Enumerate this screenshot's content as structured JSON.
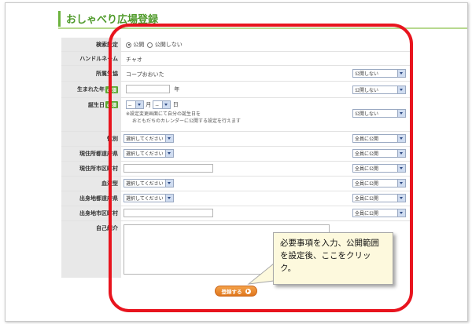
{
  "page": {
    "title": "おしゃべり広場登録"
  },
  "form": {
    "search": {
      "label": "検索設定",
      "option_public": "公開",
      "option_private": "公開しない"
    },
    "handle": {
      "label": "ハンドルネーム",
      "value": "チャオ"
    },
    "coop": {
      "label": "所属生協",
      "value": "コープおおいた",
      "visibility": "公開しない"
    },
    "birth_year": {
      "label": "生まれた年",
      "required": "必須",
      "unit": "年",
      "visibility": "公開しない"
    },
    "birthday": {
      "label": "誕生日",
      "required": "必須",
      "month_value": "--",
      "month_unit": "月",
      "day_value": "--",
      "day_unit": "日",
      "note_line1": "※設定変更画面にて自分の誕生日を",
      "note_line2": "おともだちのカレンダーに公開する設定を行えます",
      "visibility": "公開しない"
    },
    "gender": {
      "label": "性別",
      "placeholder": "選択してください",
      "visibility": "全員に公開"
    },
    "pref": {
      "label": "現住所都道府県",
      "placeholder": "選択してください",
      "visibility": "全員に公開"
    },
    "city": {
      "label": "現住所市区町村",
      "visibility": "全員に公開"
    },
    "blood": {
      "label": "血液型",
      "placeholder": "選択してください",
      "visibility": "全員に公開"
    },
    "birth_pref": {
      "label": "出身地都道府県",
      "placeholder": "選択してください",
      "visibility": "全員に公開"
    },
    "birth_city": {
      "label": "出身地市区町村",
      "visibility": "全員に公開"
    },
    "intro": {
      "label": "自己紹介"
    }
  },
  "submit": {
    "label": "登録する"
  },
  "callout": {
    "text": "必要事項を入力、公開範囲を設定後、ここをクリック。"
  },
  "colors": {
    "accent_green": "#6cb33e",
    "highlight_red": "#e8141e",
    "button_orange": "#e0761c",
    "callout_bg": "#fdf9dd"
  }
}
